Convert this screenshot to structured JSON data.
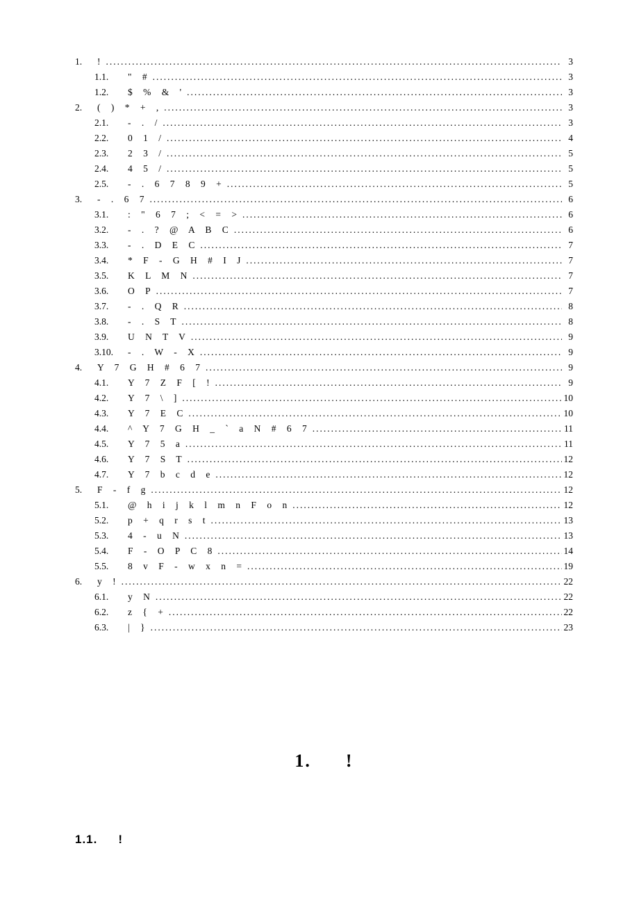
{
  "toc": [
    {
      "level": 1,
      "num": "1.",
      "title": "!",
      "page": "3"
    },
    {
      "level": 2,
      "num": "1.1.",
      "title": "\" #",
      "page": "3"
    },
    {
      "level": 2,
      "num": "1.2.",
      "title": "$ % & '",
      "page": "3"
    },
    {
      "level": 1,
      "num": "2.",
      "title": "( ) * + ,",
      "page": "3"
    },
    {
      "level": 2,
      "num": "2.1.",
      "title": "- . /",
      "page": "3"
    },
    {
      "level": 2,
      "num": "2.2.",
      "title": "0 1 /",
      "page": "4"
    },
    {
      "level": 2,
      "num": "2.3.",
      "title": "2 3 /",
      "page": "5"
    },
    {
      "level": 2,
      "num": "2.4.",
      "title": "4 5 /",
      "page": "5"
    },
    {
      "level": 2,
      "num": "2.5.",
      "title": "- . 6 7 8 9 +",
      "page": "5"
    },
    {
      "level": 1,
      "num": "3.",
      "title": "- . 6 7",
      "page": "6"
    },
    {
      "level": 2,
      "num": "3.1.",
      "title": ": \" 6 7 ; < = >",
      "page": "6"
    },
    {
      "level": 2,
      "num": "3.2.",
      "title": "- . ? @ A B C",
      "page": "6"
    },
    {
      "level": 2,
      "num": "3.3.",
      "title": "- . D E C",
      "page": "7"
    },
    {
      "level": 2,
      "num": "3.4.",
      "title": "* F - G H # I J",
      "page": "7"
    },
    {
      "level": 2,
      "num": "3.5.",
      "title": "K L M N",
      "page": "7"
    },
    {
      "level": 2,
      "num": "3.6.",
      "title": "O P",
      "page": "7"
    },
    {
      "level": 2,
      "num": "3.7.",
      "title": "- . Q R",
      "page": "8"
    },
    {
      "level": 2,
      "num": "3.8.",
      "title": "- . S T",
      "page": "8"
    },
    {
      "level": 2,
      "num": "3.9.",
      "title": "U N T V",
      "page": "9"
    },
    {
      "level": 2,
      "num": "3.10.",
      "title": "- . W -   X",
      "page": "9"
    },
    {
      "level": 1,
      "num": "4.",
      "title": "Y 7 G H # 6 7",
      "page": "9"
    },
    {
      "level": 2,
      "num": "4.1.",
      "title": "Y 7 Z F [ !",
      "page": "9"
    },
    {
      "level": 2,
      "num": "4.2.",
      "title": "Y 7 \\ ]",
      "page": "10"
    },
    {
      "level": 2,
      "num": "4.3.",
      "title": "Y 7 E C",
      "page": "10"
    },
    {
      "level": 2,
      "num": "4.4.",
      "title": "^ Y 7 G H _ ` a N # 6 7",
      "page": "11"
    },
    {
      "level": 2,
      "num": "4.5.",
      "title": "Y 7 5 a",
      "page": "11"
    },
    {
      "level": 2,
      "num": "4.6.",
      "title": "Y 7 S T",
      "page": "12"
    },
    {
      "level": 2,
      "num": "4.7.",
      "title": "Y 7 b c d e",
      "page": "12"
    },
    {
      "level": 1,
      "num": "5.",
      "title": "F - f g",
      "page": "12"
    },
    {
      "level": 2,
      "num": "5.1.",
      "title": "@ h i j k l m n F o n",
      "page": "12"
    },
    {
      "level": 2,
      "num": "5.2.",
      "title": "p + q r s t",
      "page": "13"
    },
    {
      "level": 2,
      "num": "5.3.",
      "title": "4 - u N",
      "page": "13"
    },
    {
      "level": 2,
      "num": "5.4.",
      "title": "F - O P C 8",
      "page": "14"
    },
    {
      "level": 2,
      "num": "5.5.",
      "title": "8 v F - w x n =",
      "page": "19"
    },
    {
      "level": 1,
      "num": "6.",
      "title": "y   !",
      "page": "22"
    },
    {
      "level": 2,
      "num": "6.1.",
      "title": "y N",
      "page": "22"
    },
    {
      "level": 2,
      "num": "6.2.",
      "title": "z { +",
      "page": "22"
    },
    {
      "level": 2,
      "num": "6.3.",
      "title": "| }",
      "page": "23"
    }
  ],
  "section_heading": {
    "num": "1.",
    "title": "!"
  },
  "subsection_heading": {
    "num": "1.1.",
    "title": "!"
  }
}
